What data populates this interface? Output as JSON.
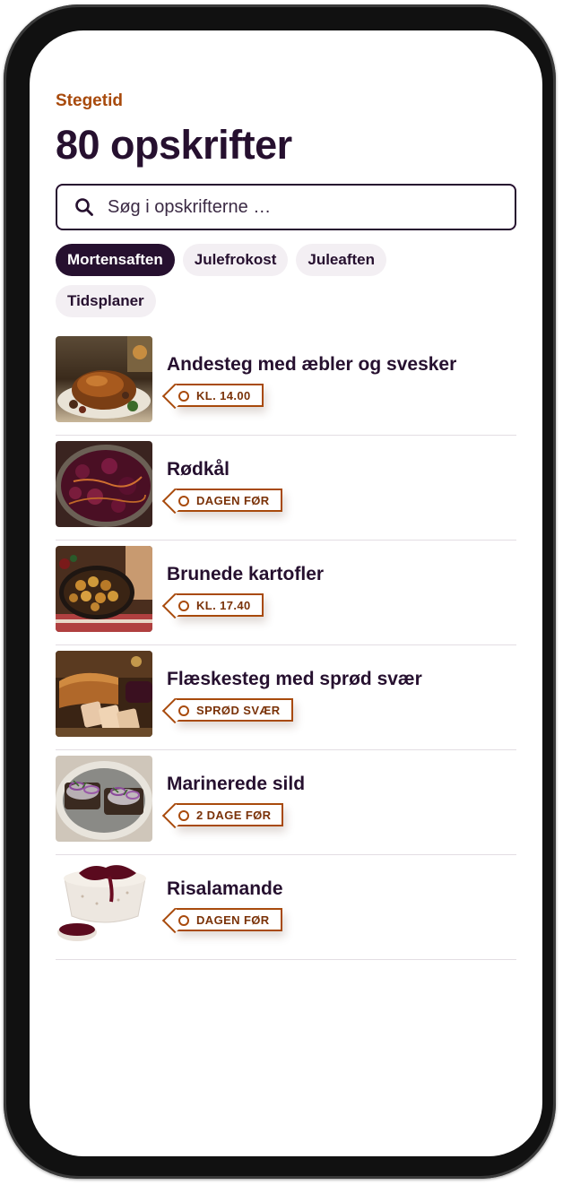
{
  "header": {
    "eyebrow": "Stegetid",
    "title": "80 opskrifter"
  },
  "search": {
    "placeholder": "Søg i opskrifterne …",
    "value": ""
  },
  "chips": [
    {
      "label": "Mortensaften",
      "active": true
    },
    {
      "label": "Julefrokost",
      "active": false
    },
    {
      "label": "Juleaften",
      "active": false
    },
    {
      "label": "Tidsplaner",
      "active": false
    }
  ],
  "recipes": [
    {
      "title": "Andesteg med æbler og svesker",
      "tag": "KL. 14.00",
      "image": "roast-duck-photo"
    },
    {
      "title": "Rødkål",
      "tag": "DAGEN FØR",
      "image": "red-cabbage-photo"
    },
    {
      "title": "Brunede kartofler",
      "tag": "KL. 17.40",
      "image": "caramelized-potatoes-photo"
    },
    {
      "title": "Flæskesteg med sprød svær",
      "tag": "SPRØD SVÆR",
      "image": "pork-roast-photo"
    },
    {
      "title": "Marinerede sild",
      "tag": "2 DAGE FØR",
      "image": "pickled-herring-photo"
    },
    {
      "title": "Risalamande",
      "tag": "DAGEN FØR",
      "image": "rice-pudding-photo"
    }
  ],
  "colors": {
    "accent": "#a84a0c",
    "ink": "#26102f",
    "chip_bg": "#f3eff3"
  }
}
